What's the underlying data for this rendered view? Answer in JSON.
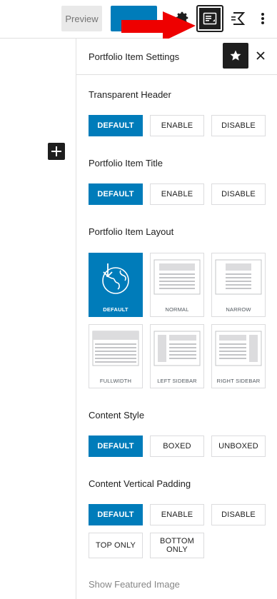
{
  "toolbar": {
    "preview_label": "Preview",
    "icons": [
      "gear-icon",
      "sidebar-settings-icon",
      "plugin-icon",
      "more-vertical-icon"
    ],
    "arrow_color": "#ee0000",
    "accent": "#007cba"
  },
  "panel": {
    "title": "Portfolio Item Settings",
    "transparent_header": {
      "label": "Transparent Header",
      "options": [
        "DEFAULT",
        "ENABLE",
        "DISABLE"
      ],
      "selected": "DEFAULT"
    },
    "item_title": {
      "label": "Portfolio Item Title",
      "options": [
        "DEFAULT",
        "ENABLE",
        "DISABLE"
      ],
      "selected": "DEFAULT"
    },
    "item_layout": {
      "label": "Portfolio Item Layout",
      "options": [
        "DEFAULT",
        "NORMAL",
        "NARROW",
        "FULLWIDTH",
        "LEFT SIDEBAR",
        "RIGHT SIDEBAR"
      ],
      "selected": "DEFAULT"
    },
    "content_style": {
      "label": "Content Style",
      "options": [
        "DEFAULT",
        "BOXED",
        "UNBOXED"
      ],
      "selected": "DEFAULT"
    },
    "vertical_padding": {
      "label": "Content Vertical Padding",
      "options": [
        "DEFAULT",
        "ENABLE",
        "DISABLE",
        "TOP ONLY",
        "BOTTOM ONLY"
      ],
      "selected": "DEFAULT"
    },
    "next_section_label": "Show Featured Image"
  }
}
